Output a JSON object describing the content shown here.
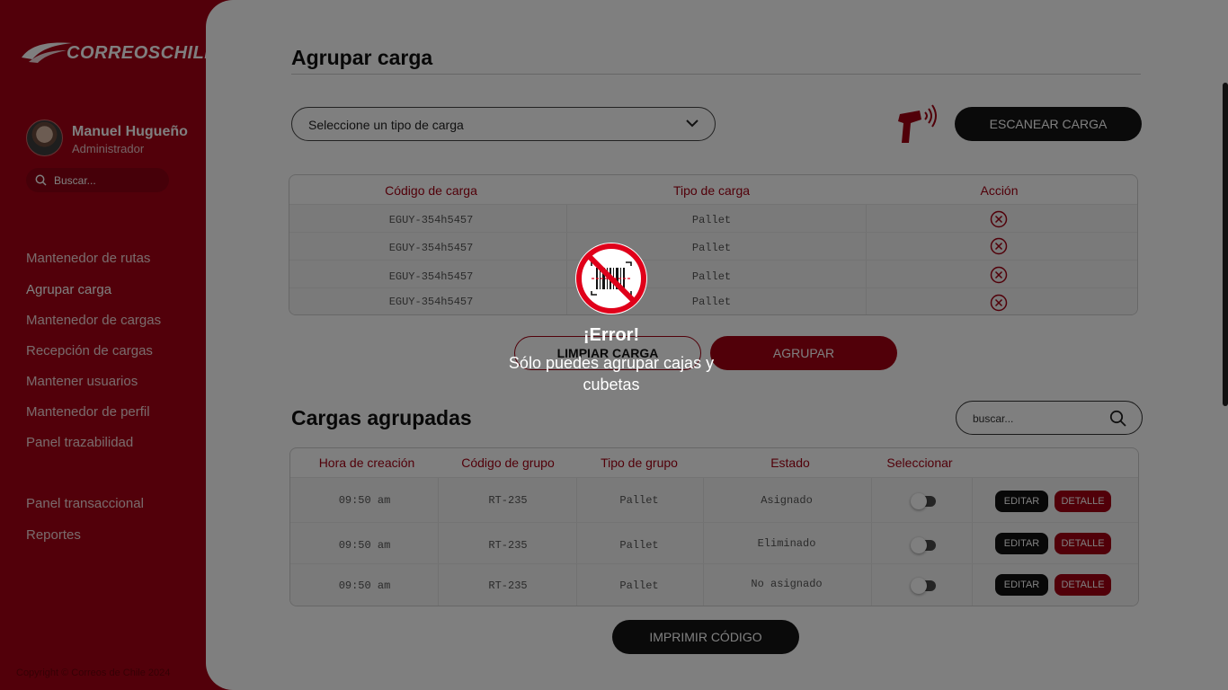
{
  "brand": {
    "logo_text": "CORREOSCHILE",
    "primary_color": "#a30013"
  },
  "user": {
    "name": "Manuel Hugueño",
    "role": "Administrador"
  },
  "sidebar": {
    "search_placeholder": "Buscar...",
    "items": [
      {
        "label": "Mantenedor de rutas"
      },
      {
        "label": "Agrupar carga",
        "active": true
      },
      {
        "label": "Mantenedor de cargas"
      },
      {
        "label": "Recepción de cargas"
      },
      {
        "label": "Mantener usuarios"
      },
      {
        "label": "Mantenedor de perfil"
      },
      {
        "label": "Panel trazabilidad"
      },
      {
        "label": "Panel transaccional"
      },
      {
        "label": "Reportes"
      }
    ],
    "footer": "Copyright © Correos de Chile 2024"
  },
  "group": {
    "title": "Agrupar carga",
    "select_placeholder": "Seleccione un tipo de carga",
    "scan_label": "ESCANEAR CARGA",
    "columns": [
      "Código de carga",
      "Tipo de carga",
      "Acción"
    ],
    "rows": [
      {
        "code": "EGUY-354h5457",
        "type": "Pallet"
      },
      {
        "code": "EGUY-354h5457",
        "type": "Pallet"
      },
      {
        "code": "EGUY-354h5457",
        "type": "Pallet"
      },
      {
        "code": "EGUY-354h5457",
        "type": "Pallet"
      }
    ],
    "clear_label": "LIMPIAR CARGA",
    "group_label": "AGRUPAR"
  },
  "grouped": {
    "title": "Cargas agrupadas",
    "search_placeholder": "buscar...",
    "columns": [
      "Hora de creación",
      "Código de grupo",
      "Tipo de grupo",
      "Estado",
      "Seleccionar"
    ],
    "rows": [
      {
        "time": "09:50 am",
        "code": "RT-235",
        "type": "Pallet",
        "status": "Asignado"
      },
      {
        "time": "09:50 am",
        "code": "RT-235",
        "type": "Pallet",
        "status": "Eliminado"
      },
      {
        "time": "09:50 am",
        "code": "RT-235",
        "type": "Pallet",
        "status": "No asignado"
      }
    ],
    "edit_label": "EDITAR",
    "detail_label": "DETALLE",
    "print_label": "IMPRIMIR CÓDIGO"
  },
  "error": {
    "title": "¡Error!",
    "message": "Sólo puedes agrupar cajas y cubetas",
    "icon": "no-barcode-icon"
  }
}
